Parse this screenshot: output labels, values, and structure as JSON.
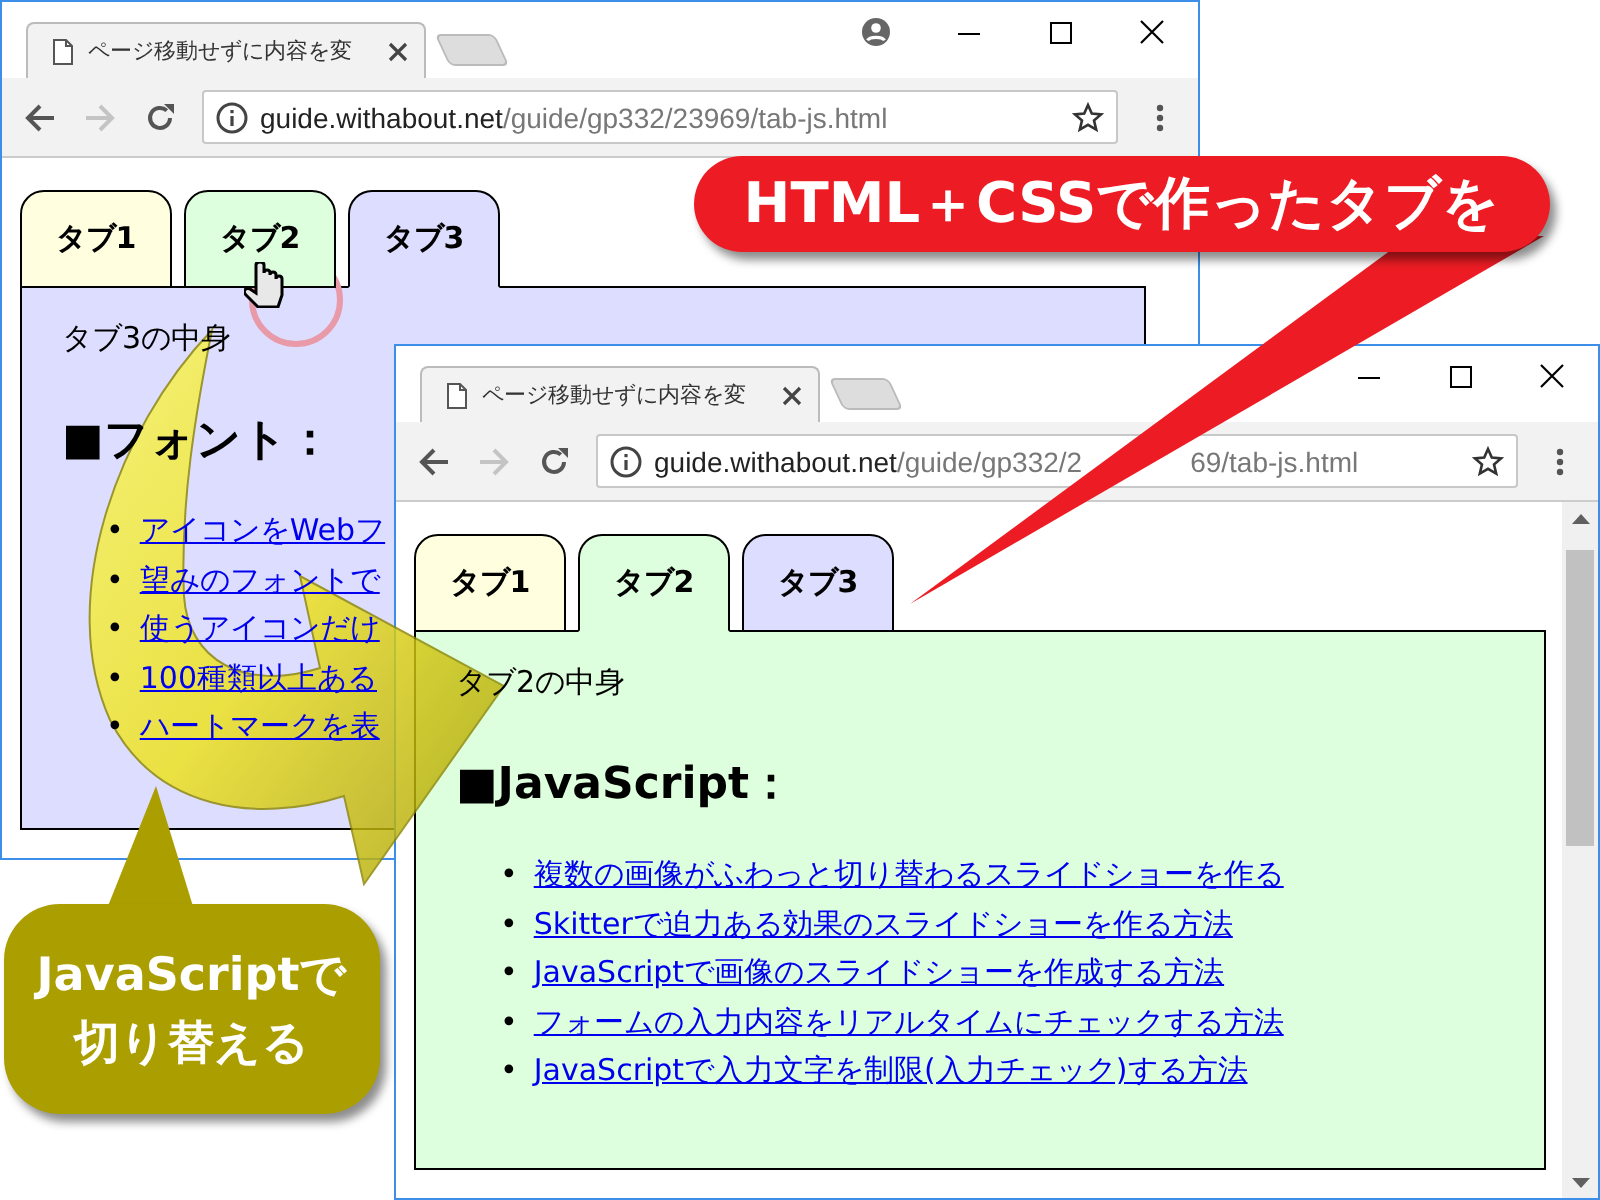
{
  "windows": [
    {
      "tab_title": "ページ移動せずに内容を変",
      "address": {
        "host": "guide.withabout.net",
        "path": [
          "/guide/gp332/23969/tab-js.html"
        ]
      },
      "page_tabs": [
        {
          "label": "タブ1",
          "selected": false,
          "color": "#ffffe0"
        },
        {
          "label": "タブ2",
          "selected": false,
          "color": "#ddffdd"
        },
        {
          "label": "タブ3",
          "selected": true,
          "color": "#ddddff"
        }
      ],
      "content": {
        "caption": "タブ3の中身",
        "heading": "■フォント：",
        "bullet": "•",
        "links": [
          "アイコンをWebフ",
          "望みのフォントで",
          "使うアイコンだけ",
          "100種類以上ある",
          "ハートマークを表"
        ]
      }
    },
    {
      "tab_title": "ページ移動せずに内容を変",
      "address": {
        "host": "guide.withabout.net",
        "path": [
          "/guide/gp332/2",
          "69/tab-js.html"
        ]
      },
      "page_tabs": [
        {
          "label": "タブ1",
          "selected": false,
          "color": "#ffffe0"
        },
        {
          "label": "タブ2",
          "selected": true,
          "color": "#ddffdd"
        },
        {
          "label": "タブ3",
          "selected": false,
          "color": "#ddddff"
        }
      ],
      "content": {
        "caption": "タブ2の中身",
        "heading": "■JavaScript：",
        "bullet": "•",
        "links": [
          "複数の画像がふわっと切り替わるスライドショーを作る",
          "Skitterで迫力ある効果のスライドショーを作る方法",
          "JavaScriptで画像のスライドショーを作成する方法",
          "フォームの入力内容をリアルタイムにチェックする方法",
          "JavaScriptで入力文字を制限(入力チェック)する方法"
        ]
      }
    }
  ],
  "callouts": [
    {
      "lines": [
        "HTML＋CSSで作ったタブを"
      ],
      "color": "#ed1c24"
    },
    {
      "lines": [
        "JavaScriptで",
        "切り替える"
      ],
      "color": "#ab9e00"
    }
  ]
}
